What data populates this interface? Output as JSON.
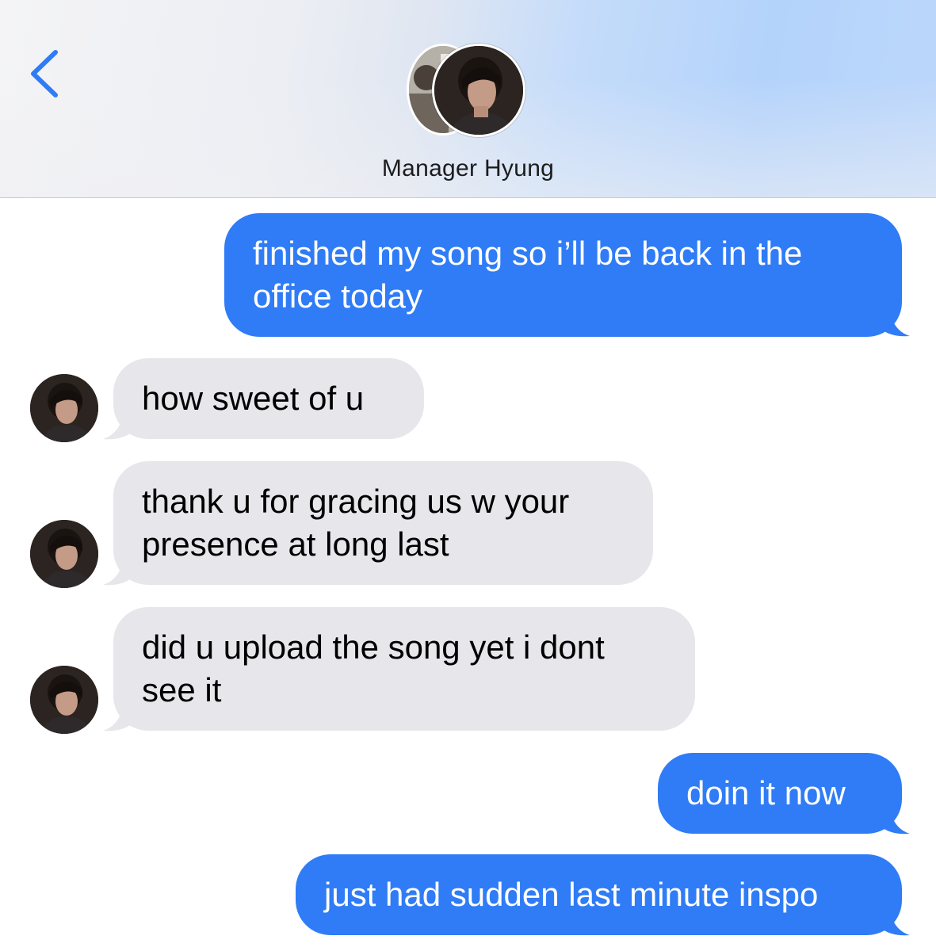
{
  "header": {
    "contact_name": "Manager Hyung",
    "back_icon": "chevron-left-icon"
  },
  "colors": {
    "sent_bubble": "#2f7cf6",
    "received_bubble": "#e6e6eb",
    "accent": "#2f7cf6"
  },
  "messages": [
    {
      "direction": "sent",
      "lines": [
        "finished my song so i’ll be back in the",
        "office today"
      ]
    },
    {
      "direction": "received",
      "lines": [
        "how sweet of u"
      ]
    },
    {
      "direction": "received",
      "lines": [
        "thank u for gracing us w your",
        "presence at long last"
      ]
    },
    {
      "direction": "received",
      "lines": [
        "did u upload the song yet i dont",
        "see it"
      ]
    },
    {
      "direction": "sent",
      "lines": [
        "doin it now"
      ]
    },
    {
      "direction": "sent",
      "lines": [
        "just had sudden last minute inspo"
      ]
    }
  ]
}
